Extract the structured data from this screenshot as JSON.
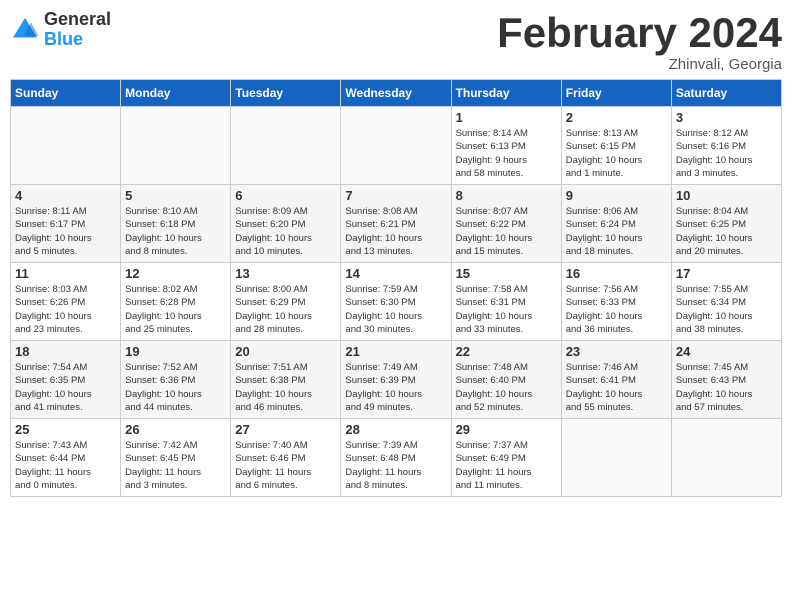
{
  "header": {
    "logo_general": "General",
    "logo_blue": "Blue",
    "month_title": "February 2024",
    "subtitle": "Zhinvali, Georgia"
  },
  "weekdays": [
    "Sunday",
    "Monday",
    "Tuesday",
    "Wednesday",
    "Thursday",
    "Friday",
    "Saturday"
  ],
  "weeks": [
    [
      {
        "day": "",
        "info": ""
      },
      {
        "day": "",
        "info": ""
      },
      {
        "day": "",
        "info": ""
      },
      {
        "day": "",
        "info": ""
      },
      {
        "day": "1",
        "info": "Sunrise: 8:14 AM\nSunset: 6:13 PM\nDaylight: 9 hours\nand 58 minutes."
      },
      {
        "day": "2",
        "info": "Sunrise: 8:13 AM\nSunset: 6:15 PM\nDaylight: 10 hours\nand 1 minute."
      },
      {
        "day": "3",
        "info": "Sunrise: 8:12 AM\nSunset: 6:16 PM\nDaylight: 10 hours\nand 3 minutes."
      }
    ],
    [
      {
        "day": "4",
        "info": "Sunrise: 8:11 AM\nSunset: 6:17 PM\nDaylight: 10 hours\nand 5 minutes."
      },
      {
        "day": "5",
        "info": "Sunrise: 8:10 AM\nSunset: 6:18 PM\nDaylight: 10 hours\nand 8 minutes."
      },
      {
        "day": "6",
        "info": "Sunrise: 8:09 AM\nSunset: 6:20 PM\nDaylight: 10 hours\nand 10 minutes."
      },
      {
        "day": "7",
        "info": "Sunrise: 8:08 AM\nSunset: 6:21 PM\nDaylight: 10 hours\nand 13 minutes."
      },
      {
        "day": "8",
        "info": "Sunrise: 8:07 AM\nSunset: 6:22 PM\nDaylight: 10 hours\nand 15 minutes."
      },
      {
        "day": "9",
        "info": "Sunrise: 8:06 AM\nSunset: 6:24 PM\nDaylight: 10 hours\nand 18 minutes."
      },
      {
        "day": "10",
        "info": "Sunrise: 8:04 AM\nSunset: 6:25 PM\nDaylight: 10 hours\nand 20 minutes."
      }
    ],
    [
      {
        "day": "11",
        "info": "Sunrise: 8:03 AM\nSunset: 6:26 PM\nDaylight: 10 hours\nand 23 minutes."
      },
      {
        "day": "12",
        "info": "Sunrise: 8:02 AM\nSunset: 6:28 PM\nDaylight: 10 hours\nand 25 minutes."
      },
      {
        "day": "13",
        "info": "Sunrise: 8:00 AM\nSunset: 6:29 PM\nDaylight: 10 hours\nand 28 minutes."
      },
      {
        "day": "14",
        "info": "Sunrise: 7:59 AM\nSunset: 6:30 PM\nDaylight: 10 hours\nand 30 minutes."
      },
      {
        "day": "15",
        "info": "Sunrise: 7:58 AM\nSunset: 6:31 PM\nDaylight: 10 hours\nand 33 minutes."
      },
      {
        "day": "16",
        "info": "Sunrise: 7:56 AM\nSunset: 6:33 PM\nDaylight: 10 hours\nand 36 minutes."
      },
      {
        "day": "17",
        "info": "Sunrise: 7:55 AM\nSunset: 6:34 PM\nDaylight: 10 hours\nand 38 minutes."
      }
    ],
    [
      {
        "day": "18",
        "info": "Sunrise: 7:54 AM\nSunset: 6:35 PM\nDaylight: 10 hours\nand 41 minutes."
      },
      {
        "day": "19",
        "info": "Sunrise: 7:52 AM\nSunset: 6:36 PM\nDaylight: 10 hours\nand 44 minutes."
      },
      {
        "day": "20",
        "info": "Sunrise: 7:51 AM\nSunset: 6:38 PM\nDaylight: 10 hours\nand 46 minutes."
      },
      {
        "day": "21",
        "info": "Sunrise: 7:49 AM\nSunset: 6:39 PM\nDaylight: 10 hours\nand 49 minutes."
      },
      {
        "day": "22",
        "info": "Sunrise: 7:48 AM\nSunset: 6:40 PM\nDaylight: 10 hours\nand 52 minutes."
      },
      {
        "day": "23",
        "info": "Sunrise: 7:46 AM\nSunset: 6:41 PM\nDaylight: 10 hours\nand 55 minutes."
      },
      {
        "day": "24",
        "info": "Sunrise: 7:45 AM\nSunset: 6:43 PM\nDaylight: 10 hours\nand 57 minutes."
      }
    ],
    [
      {
        "day": "25",
        "info": "Sunrise: 7:43 AM\nSunset: 6:44 PM\nDaylight: 11 hours\nand 0 minutes."
      },
      {
        "day": "26",
        "info": "Sunrise: 7:42 AM\nSunset: 6:45 PM\nDaylight: 11 hours\nand 3 minutes."
      },
      {
        "day": "27",
        "info": "Sunrise: 7:40 AM\nSunset: 6:46 PM\nDaylight: 11 hours\nand 6 minutes."
      },
      {
        "day": "28",
        "info": "Sunrise: 7:39 AM\nSunset: 6:48 PM\nDaylight: 11 hours\nand 8 minutes."
      },
      {
        "day": "29",
        "info": "Sunrise: 7:37 AM\nSunset: 6:49 PM\nDaylight: 11 hours\nand 11 minutes."
      },
      {
        "day": "",
        "info": ""
      },
      {
        "day": "",
        "info": ""
      }
    ]
  ]
}
